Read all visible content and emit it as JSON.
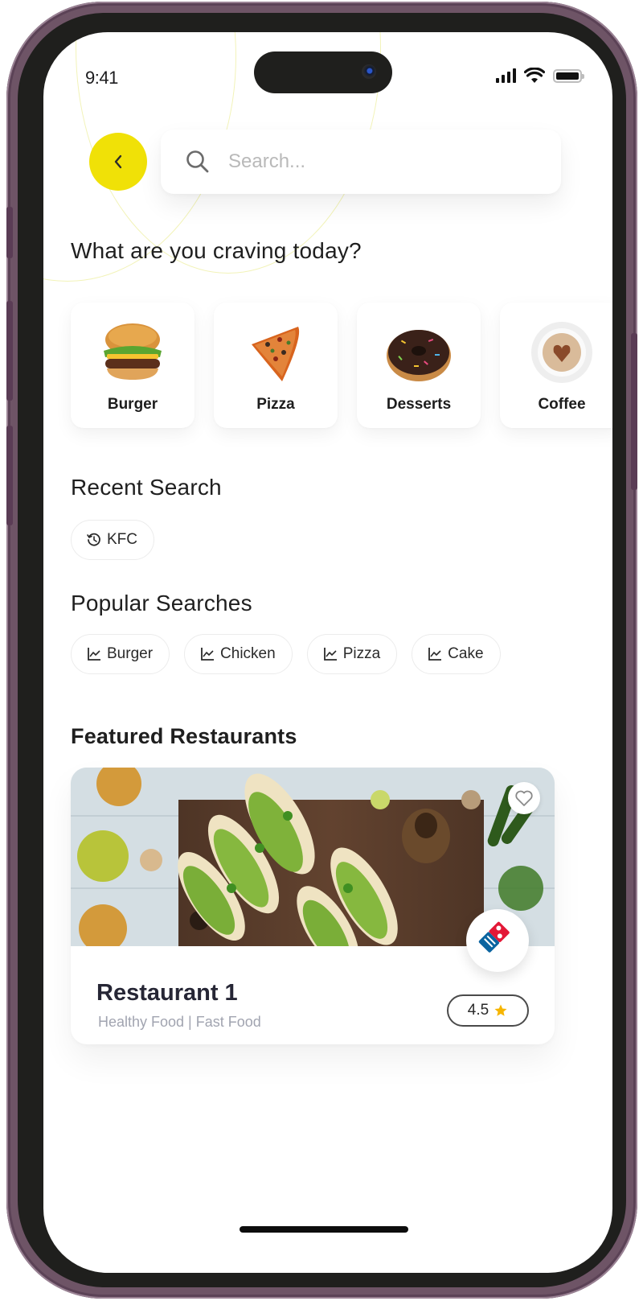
{
  "status_bar": {
    "time": "9:41",
    "icons": [
      "cellular-signal-icon",
      "wifi-icon",
      "battery-icon"
    ]
  },
  "header": {
    "back_icon": "chevron-left-icon",
    "search": {
      "icon": "search-icon",
      "placeholder": "Search...",
      "value": ""
    }
  },
  "craving": {
    "title": "What are you craving today?",
    "categories": [
      {
        "label": "Burger",
        "image": "burger-image"
      },
      {
        "label": "Pizza",
        "image": "pizza-slice-image"
      },
      {
        "label": "Desserts",
        "image": "donut-image"
      },
      {
        "label": "Coffee",
        "image": "coffee-cup-image"
      }
    ]
  },
  "recent_search": {
    "title": "Recent Search",
    "icon": "history-icon",
    "items": [
      "KFC"
    ]
  },
  "popular_searches": {
    "title": "Popular Searches",
    "icon": "trending-icon",
    "items": [
      "Burger",
      "Chicken",
      "Pizza",
      "Cake"
    ]
  },
  "featured": {
    "title": "Featured Restaurants",
    "restaurants": [
      {
        "name": "Restaurant 1",
        "tags": "Healthy Food | Fast Food",
        "rating": "4.5",
        "rating_icon": "star-icon",
        "favorite_icon": "heart-outline-icon",
        "logo": "dominos-pizza-logo",
        "photo": "tacos-photo"
      }
    ]
  },
  "colors": {
    "accent_yellow": "#f0e107",
    "star": "#f6b500",
    "frame": "#6e5466",
    "tag_text": "#a1a4b0"
  }
}
